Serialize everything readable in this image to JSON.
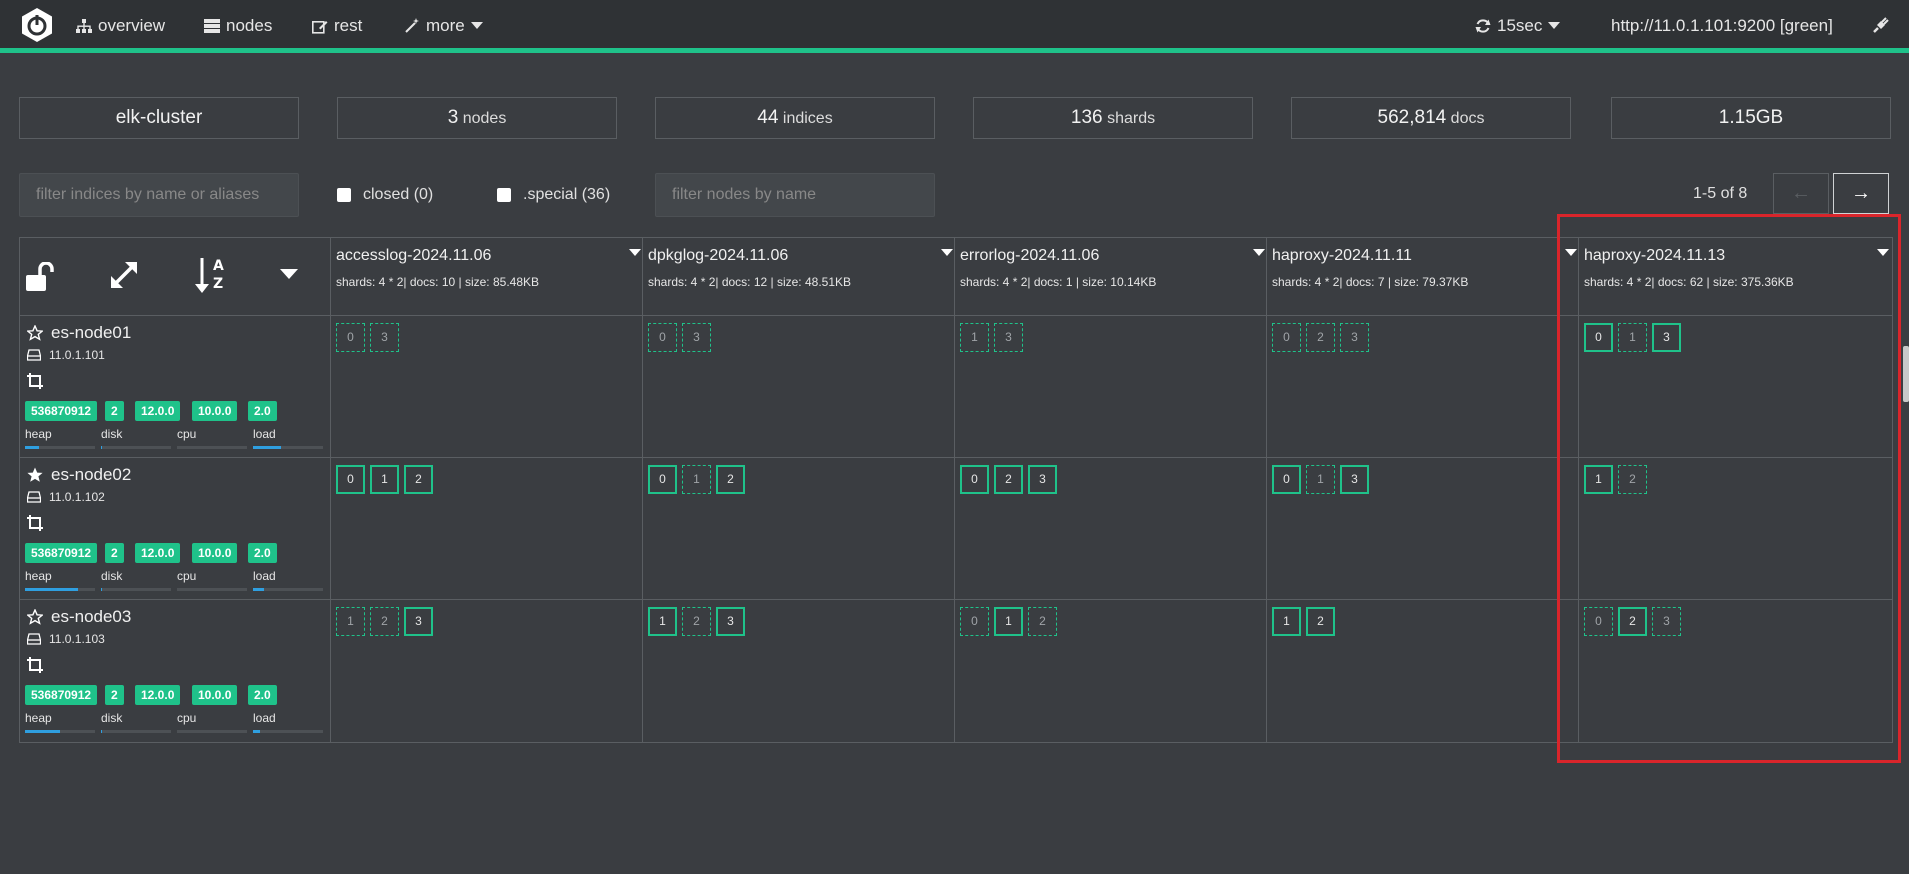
{
  "nav": {
    "overview": "overview",
    "nodes": "nodes",
    "rest": "rest",
    "more": "more",
    "refresh": "15sec",
    "connection": "http://11.0.1.101:9200 [green]"
  },
  "stats": {
    "cluster": "elk-cluster",
    "nodes_num": "3",
    "nodes_lbl": "nodes",
    "indices_num": "44",
    "indices_lbl": "indices",
    "shards_num": "136",
    "shards_lbl": "shards",
    "docs_num": "562,814",
    "docs_lbl": "docs",
    "size": "1.15GB"
  },
  "filters": {
    "indices_placeholder": "filter indices by name or aliases",
    "closed": "closed (0)",
    "special": ".special (36)",
    "nodes_placeholder": "filter nodes by name"
  },
  "pager": {
    "text": "1-5 of 8",
    "prev": "←",
    "next": "→"
  },
  "indices": [
    {
      "name": "accesslog-2024.11.06",
      "meta": "shards: 4 * 2| docs: 10 | size: 85.48KB"
    },
    {
      "name": "dpkglog-2024.11.06",
      "meta": "shards: 4 * 2| docs: 12 | size: 48.51KB"
    },
    {
      "name": "errorlog-2024.11.06",
      "meta": "shards: 4 * 2| docs: 1 | size: 10.14KB"
    },
    {
      "name": "haproxy-2024.11.11",
      "meta": "shards: 4 * 2| docs: 7 | size: 79.37KB"
    },
    {
      "name": "haproxy-2024.11.13",
      "meta": "shards: 4 * 2| docs: 62 | size: 375.36KB"
    }
  ],
  "nodes": [
    {
      "name": "es-node01",
      "ip": "11.0.1.101",
      "master": false,
      "badges": [
        "536870912",
        "2",
        "12.0.0",
        "10.0.0",
        "2.0"
      ],
      "metrics": {
        "heap": 0.2,
        "disk": 0.02,
        "cpu": 0.0,
        "load": 0.4
      }
    },
    {
      "name": "es-node02",
      "ip": "11.0.1.102",
      "master": true,
      "badges": [
        "536870912",
        "2",
        "12.0.0",
        "10.0.0",
        "2.0"
      ],
      "metrics": {
        "heap": 0.75,
        "disk": 0.02,
        "cpu": 0.0,
        "load": 0.15
      }
    },
    {
      "name": "es-node03",
      "ip": "11.0.1.103",
      "master": false,
      "badges": [
        "536870912",
        "2",
        "12.0.0",
        "10.0.0",
        "2.0"
      ],
      "metrics": {
        "heap": 0.5,
        "disk": 0.02,
        "cpu": 0.0,
        "load": 0.1
      }
    }
  ],
  "metric_labels": {
    "heap": "heap",
    "disk": "disk",
    "cpu": "cpu",
    "load": "load"
  },
  "shards": [
    [
      [
        [
          "0",
          "r"
        ],
        [
          "3",
          "r"
        ]
      ],
      [
        [
          "0",
          "r"
        ],
        [
          "3",
          "r"
        ]
      ],
      [
        [
          "1",
          "r"
        ],
        [
          "3",
          "r"
        ]
      ],
      [
        [
          "0",
          "r"
        ],
        [
          "2",
          "r"
        ],
        [
          "3",
          "r"
        ]
      ],
      [
        [
          "0",
          "p"
        ],
        [
          "1",
          "r"
        ],
        [
          "3",
          "p"
        ]
      ]
    ],
    [
      [
        [
          "0",
          "p"
        ],
        [
          "1",
          "p"
        ],
        [
          "2",
          "p"
        ]
      ],
      [
        [
          "0",
          "p"
        ],
        [
          "1",
          "r"
        ],
        [
          "2",
          "p"
        ]
      ],
      [
        [
          "0",
          "p"
        ],
        [
          "2",
          "p"
        ],
        [
          "3",
          "p"
        ]
      ],
      [
        [
          "0",
          "p"
        ],
        [
          "1",
          "r"
        ],
        [
          "3",
          "p"
        ]
      ],
      [
        [
          "1",
          "p"
        ],
        [
          "2",
          "r"
        ]
      ]
    ],
    [
      [
        [
          "1",
          "r"
        ],
        [
          "2",
          "r"
        ],
        [
          "3",
          "p"
        ]
      ],
      [
        [
          "1",
          "p"
        ],
        [
          "2",
          "r"
        ],
        [
          "3",
          "p"
        ]
      ],
      [
        [
          "0",
          "r"
        ],
        [
          "1",
          "p"
        ],
        [
          "2",
          "r"
        ]
      ],
      [
        [
          "1",
          "p"
        ],
        [
          "2",
          "p"
        ]
      ],
      [
        [
          "0",
          "r"
        ],
        [
          "2",
          "p"
        ],
        [
          "3",
          "r"
        ]
      ]
    ]
  ],
  "colors": {
    "accent": "#1fc28a",
    "highlight": "#d9252b",
    "background": "#3a3d41"
  }
}
